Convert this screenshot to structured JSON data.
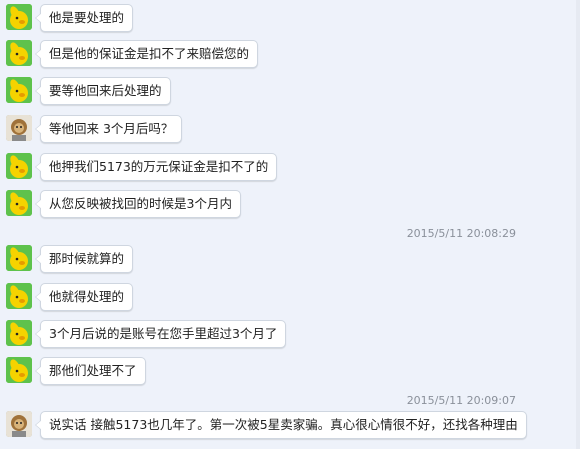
{
  "colors": {
    "background": "#eef2fa",
    "bubble": "#ffffff",
    "bubble_border": "#cfd6e0",
    "agent_avatar": "#5ec24c",
    "timestamp": "#8a909a"
  },
  "messages": [
    {
      "sender": "agent",
      "text": "他是要处理的"
    },
    {
      "sender": "agent",
      "text": "但是他的保证金是扣不了来赔偿您的"
    },
    {
      "sender": "agent",
      "text": "要等他回来后处理的"
    },
    {
      "sender": "user",
      "text": "等他回来 3个月后吗？"
    },
    {
      "sender": "agent",
      "text": "他押我们5173的万元保证金是扣不了的"
    },
    {
      "sender": "agent",
      "text": "从您反映被找回的时候是3个月内"
    },
    {
      "timestamp": "2015/5/11 20:08:29"
    },
    {
      "sender": "agent",
      "text": "那时候就算的"
    },
    {
      "sender": "agent",
      "text": "他就得处理的"
    },
    {
      "sender": "agent",
      "text": "3个月后说的是账号在您手里超过3个月了"
    },
    {
      "sender": "agent",
      "text": "那他们处理不了"
    },
    {
      "timestamp": "2015/5/11 20:09:07"
    },
    {
      "sender": "user",
      "text": " 说实话 接触5173也几年了。第一次被5星卖家骗。真心很心情很不好，还找各种理由"
    }
  ]
}
